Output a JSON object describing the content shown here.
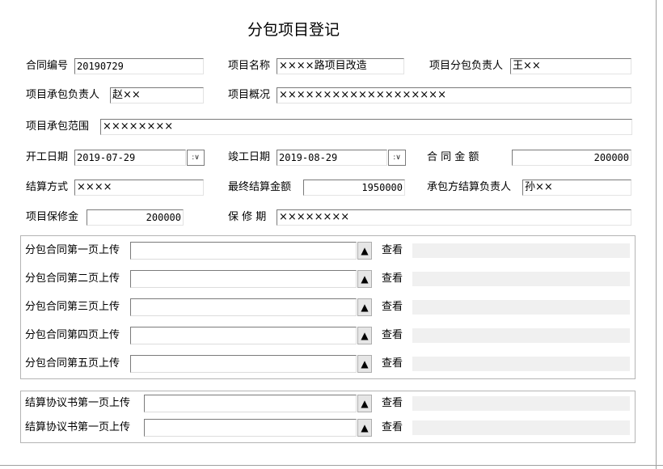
{
  "page_title": "分包项目登记",
  "labels": {
    "contract_no": "合同编号",
    "project_name": "项目名称",
    "sub_manager": "项目分包负责人",
    "contractor_manager": "项目承包负责人",
    "overview": "项目概况",
    "scope": "项目承包范围",
    "start_date": "开工日期",
    "end_date": "竣工日期",
    "contract_amount": "合 同 金 额",
    "settle_method": "结算方式",
    "final_amount": "最终结算金额",
    "settle_manager": "承包方结算负责人",
    "deposit": "项目保修金",
    "warranty": "保 修 期"
  },
  "values": {
    "contract_no": "20190729",
    "project_name": "××××路项目改造",
    "sub_manager": "王××",
    "contractor_manager": "赵××",
    "overview": "×××××××××××××××××××",
    "scope": "××××××××",
    "start_date": "2019-07-29",
    "end_date": "2019-08-29",
    "contract_amount": "200000",
    "settle_method": "××××",
    "final_amount": "1950000",
    "settle_manager": "孙××",
    "deposit": "200000",
    "warranty": "××××××××"
  },
  "dropdown_glyph": ":∨",
  "upload_button_glyph": "▲",
  "view_label": "查看",
  "contract_uploads": [
    {
      "label": "分包合同第一页上传"
    },
    {
      "label": "分包合同第二页上传"
    },
    {
      "label": "分包合同第三页上传"
    },
    {
      "label": "分包合同第四页上传"
    },
    {
      "label": "分包合同第五页上传"
    }
  ],
  "settlement_uploads": [
    {
      "label": "结算协议书第一页上传"
    },
    {
      "label": "结算协议书第一页上传"
    }
  ]
}
